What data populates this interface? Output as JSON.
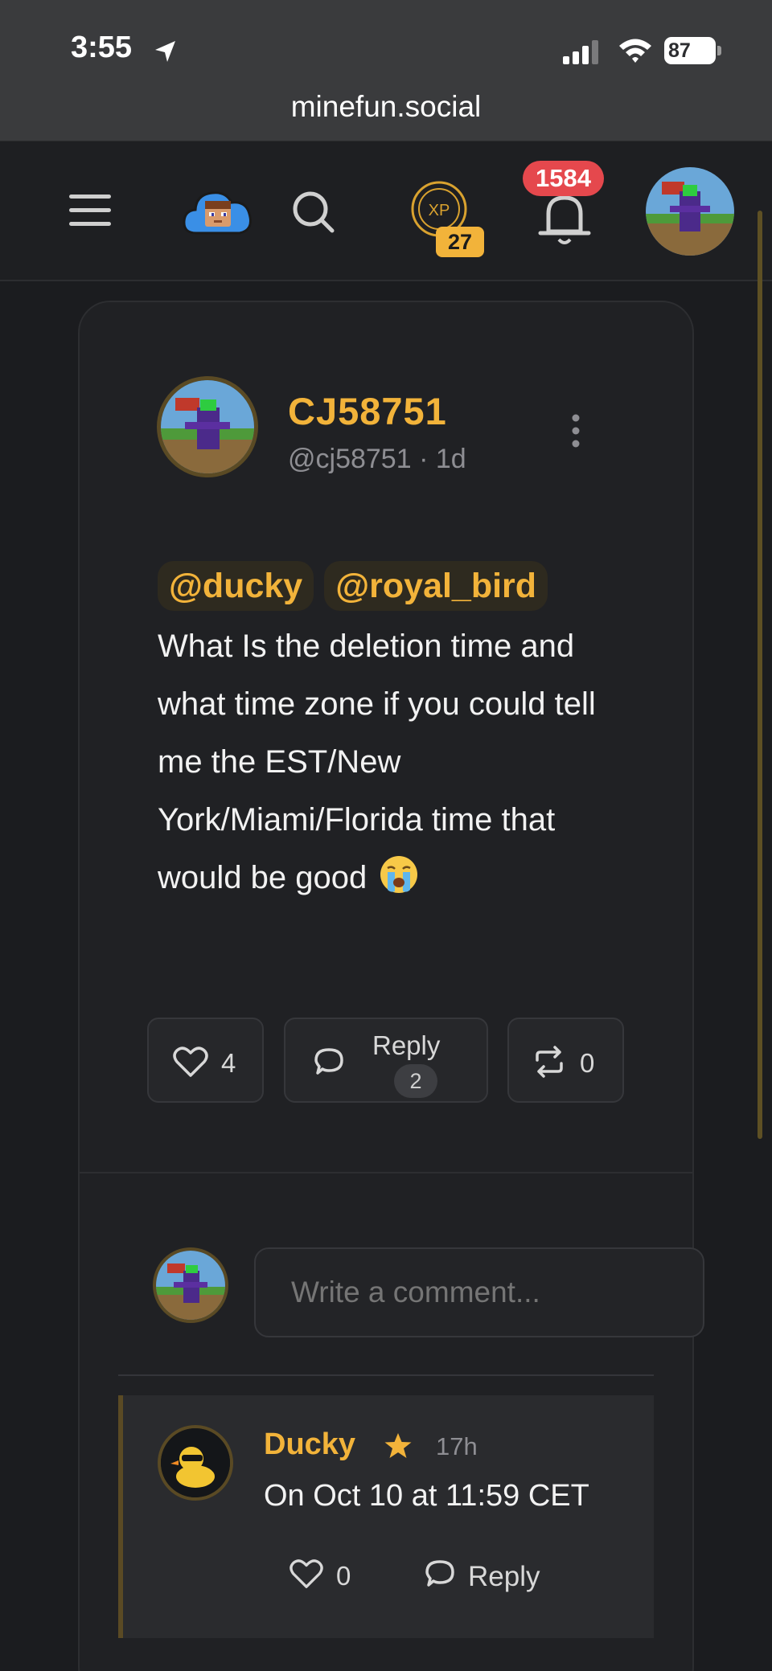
{
  "status_bar": {
    "time": "3:55",
    "battery": "87"
  },
  "browser": {
    "url": "minefun.social"
  },
  "header": {
    "xp_level": "27",
    "notifications": "1584"
  },
  "post": {
    "author_name": "CJ58751",
    "author_handle": "@cj58751",
    "age": "1d",
    "mentions": [
      "@ducky",
      "@royal_bird"
    ],
    "body": "What Is the deletion time and what time zone if you could tell me the EST/New York/Miami/Florida time that would be good",
    "likes": "4",
    "reply_label": "Reply",
    "replies": "2",
    "reposts": "0"
  },
  "comment_box": {
    "placeholder": "Write a comment..."
  },
  "reply": {
    "author": "Ducky",
    "time": "17h",
    "text": "On Oct 10 at 11:59 CET",
    "likes": "0",
    "reply_label": "Reply"
  },
  "colors": {
    "accent": "#f2b33a",
    "badge": "#e5484d",
    "background": "#1b1c1f"
  },
  "icons": [
    "location-arrow-icon",
    "signal-icon",
    "wifi-icon",
    "battery-icon",
    "menu-icon",
    "cloud-logo",
    "search-icon",
    "xp-icon",
    "bell-icon",
    "more-vertical-icon",
    "heart-icon",
    "comment-icon",
    "repost-icon",
    "star-icon",
    "crying-emoji"
  ]
}
